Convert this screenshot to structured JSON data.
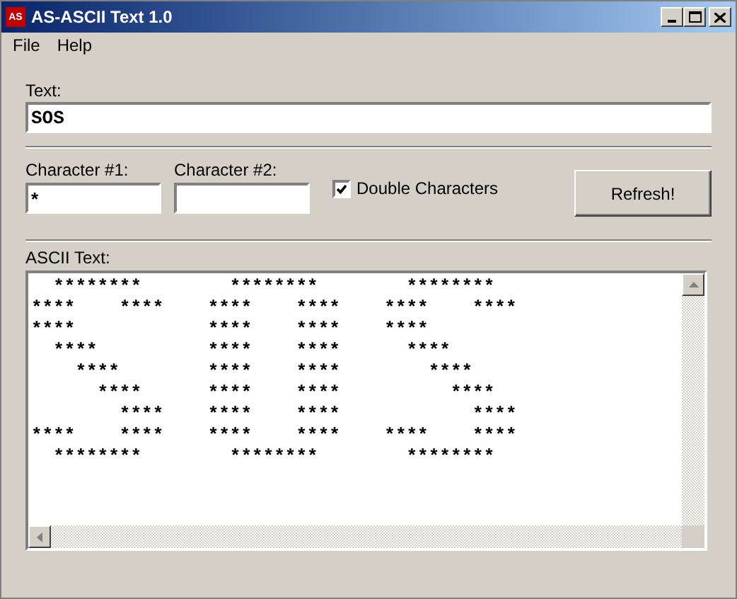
{
  "window": {
    "title": "AS-ASCII Text 1.0",
    "app_icon": "AS"
  },
  "menu": [
    "File",
    "Help"
  ],
  "text_field": {
    "label": "Text:",
    "value": "SOS"
  },
  "character_1": {
    "label": "Character #1:",
    "value": "*"
  },
  "character_2": {
    "label": "Character #2:"
  },
  "double_characters": {
    "label": "Double Characters",
    "checked": true
  },
  "refresh_button": "Refresh!",
  "ascii_text": {
    "label": "ASCII Text:",
    "text": "  ********        ********        ********\n****    ****    ****    ****    ****    ****\n****            ****    ****    ****\n  ****          ****    ****      ****\n    ****        ****    ****        ****\n      ****      ****    ****          ****\n        ****    ****    ****            ****\n****    ****    ****    ****    ****    ****\n  ********        ********        ********"
  }
}
